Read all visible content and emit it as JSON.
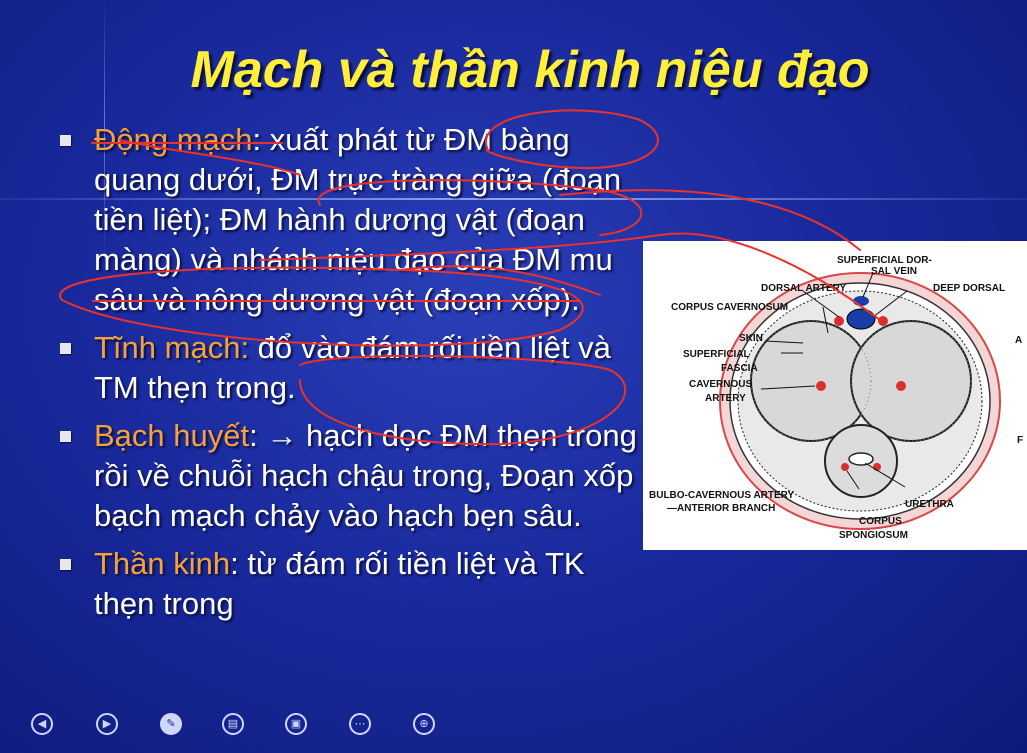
{
  "slide": {
    "title": "Mạch và thần kinh niệu đạo",
    "bullets": [
      {
        "term": "Động mạch",
        "text": ": xuất phát từ ĐM bàng quang dưới, ĐM trực tràng giữa (đoạn tiền liệt); ĐM hành dương vật (đoạn màng) và nhánh niệu đạo của ĐM mu sâu và nông dương vật (đoạn xốp)."
      },
      {
        "term": "Tĩnh mạch:",
        "text": " đổ vào đám rối tiền liệt và TM thẹn trong."
      },
      {
        "term": "Bạch huyết",
        "text": ": → hạch dọc ĐM thẹn trong rồi về chuỗi hạch chậu trong, Đoạn xốp bạch mạch chảy vào hạch bẹn sâu."
      },
      {
        "term": "Thần kinh",
        "text": ": từ đám rối tiền liệt và TK thẹn trong"
      }
    ],
    "figure_labels": {
      "superficial_dorsal_1": "SUPERFICIAL DOR-",
      "superficial_dorsal_2": "SAL VEIN",
      "dorsal_artery": "DORSAL ARTERY",
      "deep_dorsal": "DEEP DORSAL",
      "corpus_cavernosum": "CORPUS CAVERNOSUM",
      "skin": "SKIN",
      "superficial_fascia_1": "SUPERFICIAL",
      "superficial_fascia_2": "FASCIA",
      "cavernous_artery_1": "CAVERNOUS",
      "cavernous_artery_2": "ARTERY",
      "bulbo_1": "BULBO-CAVERNOUS ARTERY",
      "bulbo_2": "—ANTERIOR BRANCH",
      "urethra": "URETHRA",
      "corpus_spongiosum_1": "CORPUS",
      "corpus_spongiosum_2": "SPONGIOSUM",
      "edge_a": "A",
      "edge_f": "F"
    }
  },
  "navbar": {
    "buttons": [
      {
        "name": "previous-slide-icon",
        "glyph": "◀"
      },
      {
        "name": "next-slide-icon",
        "glyph": "▶"
      },
      {
        "name": "pen-icon",
        "glyph": "✎"
      },
      {
        "name": "slides-grid-icon",
        "glyph": "▤"
      },
      {
        "name": "screen-icon",
        "glyph": "▣"
      },
      {
        "name": "more-options-icon",
        "glyph": "⋯"
      },
      {
        "name": "zoom-icon",
        "glyph": "⊕"
      }
    ]
  },
  "colors": {
    "title": "#ffef3a",
    "term": "#f5a23a",
    "ink": "#e8322a",
    "background": "#1a2a9e"
  }
}
